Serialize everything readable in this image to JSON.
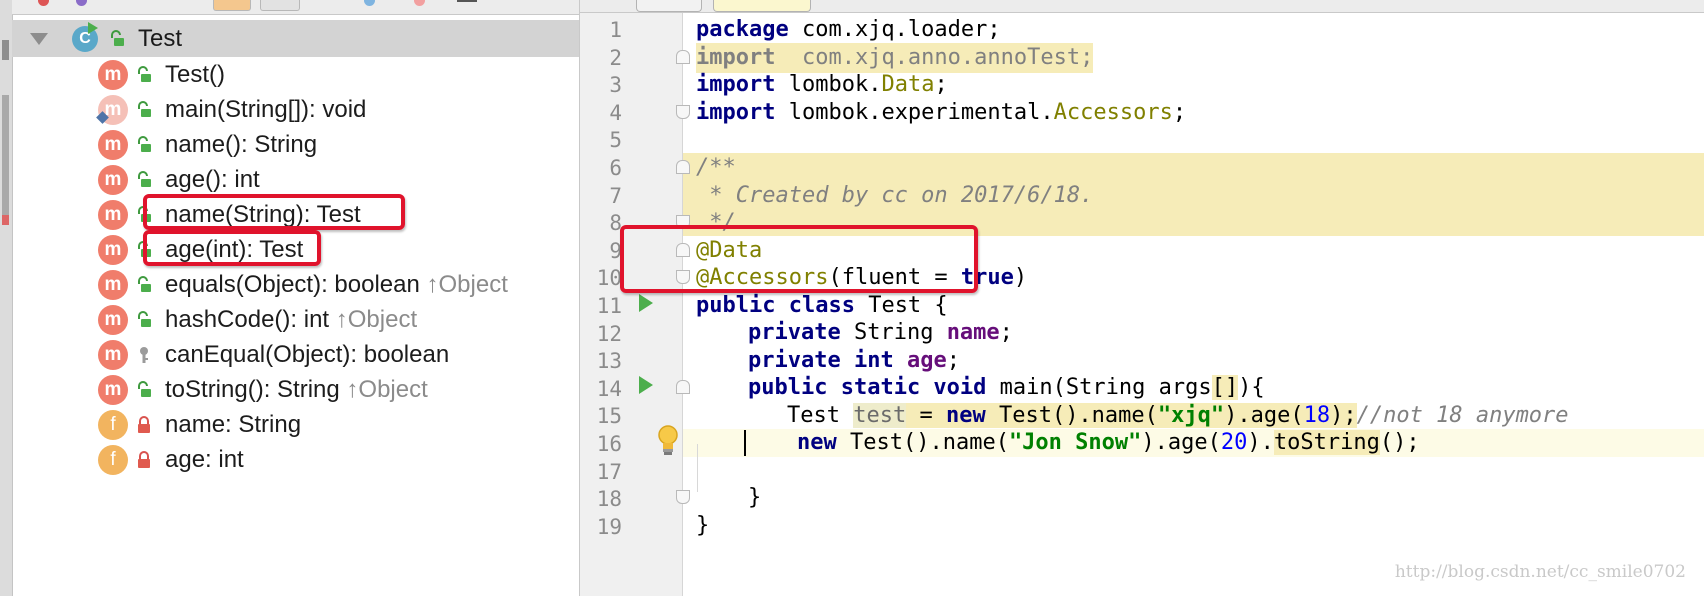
{
  "structure": {
    "root": {
      "label": "Test",
      "icon": "class-icon"
    },
    "items": [
      {
        "kind": "m",
        "name": "Test()",
        "inherit": "",
        "access": "public",
        "faded": false
      },
      {
        "kind": "m",
        "name": "main(String[]): void",
        "inherit": "",
        "access": "public",
        "faded": true
      },
      {
        "kind": "m",
        "name": "name(): String",
        "inherit": "",
        "access": "public",
        "faded": false
      },
      {
        "kind": "m",
        "name": "age(): int",
        "inherit": "",
        "access": "public",
        "faded": false
      },
      {
        "kind": "m",
        "name": "name(String): Test",
        "inherit": "",
        "access": "public",
        "faded": false
      },
      {
        "kind": "m",
        "name": "age(int): Test",
        "inherit": "",
        "access": "public",
        "faded": false
      },
      {
        "kind": "m",
        "name": "equals(Object): boolean",
        "inherit": "↑Object",
        "access": "public",
        "faded": false
      },
      {
        "kind": "m",
        "name": "hashCode(): int",
        "inherit": "↑Object",
        "access": "public",
        "faded": false
      },
      {
        "kind": "m",
        "name": "canEqual(Object): boolean",
        "inherit": "",
        "access": "protected",
        "faded": false
      },
      {
        "kind": "m",
        "name": "toString(): String",
        "inherit": "↑Object",
        "access": "public",
        "faded": false
      },
      {
        "kind": "f",
        "name": "name: String",
        "inherit": "",
        "access": "private",
        "faded": false
      },
      {
        "kind": "f",
        "name": "age: int",
        "inherit": "",
        "access": "private",
        "faded": false
      }
    ]
  },
  "editor": {
    "line_numbers": [
      "1",
      "2",
      "3",
      "4",
      "5",
      "6",
      "7",
      "8",
      "9",
      "10",
      "11",
      "12",
      "13",
      "14",
      "15",
      "16",
      "17",
      "18",
      "19"
    ],
    "code": {
      "l1_kw": "package",
      "l1_rest": " com.xjq.loader;",
      "l2_kw": "import",
      "l2_rest": "  com.xjq.anno.annoTest;",
      "l3_kw": "import",
      "l3_a": " lombok.",
      "l3_b": "Data",
      "l3_c": ";",
      "l4_kw": "import",
      "l4_a": " lombok.experimental.",
      "l4_b": "Accessors",
      "l4_c": ";",
      "l6": "/**",
      "l7": " * Created by cc on 2017/6/18.",
      "l8": " */",
      "l9": "@Data",
      "l10_ann": "@Accessors",
      "l10_a": "(fluent = ",
      "l10_kw": "true",
      "l10_b": ")",
      "l11_kw": "public class",
      "l11_rest": " Test {",
      "l12_kw": "private",
      "l12_a": " String ",
      "l12_f": "name",
      "l12_b": ";",
      "l13_kw": "private int",
      "l13_a": " ",
      "l13_f": "age",
      "l13_b": ";",
      "l14_kw": "public static void",
      "l14_a": " main(String args",
      "l14_br": "[]",
      "l14_b": "){",
      "l15_a": "Test ",
      "l15_var": "test",
      "l15_b": " = ",
      "l15_kw": "new",
      "l15_c": " Test().name(",
      "l15_str": "\"xjq\"",
      "l15_d": ").age(",
      "l15_num": "18",
      "l15_e": ");",
      "l15_cmt": "//not 18 anymore",
      "l16_kw": "new",
      "l16_a": " Test().name(",
      "l16_str": "\"Jon Snow\"",
      "l16_b": ").age(",
      "l16_num": "20",
      "l16_c": ").",
      "l16_m": "toString",
      "l16_d": "();",
      "l18": "}",
      "l19": "}"
    },
    "watermark": "http://blog.csdn.net/cc_smile0702"
  },
  "colors": {
    "highlight_box": "#e0132c",
    "method_badge": "#f07d6b",
    "field_badge": "#f2b45f",
    "keyword": "#000080",
    "annotation": "#808000",
    "string": "#008000",
    "doc_bg": "#f6ecb8"
  }
}
